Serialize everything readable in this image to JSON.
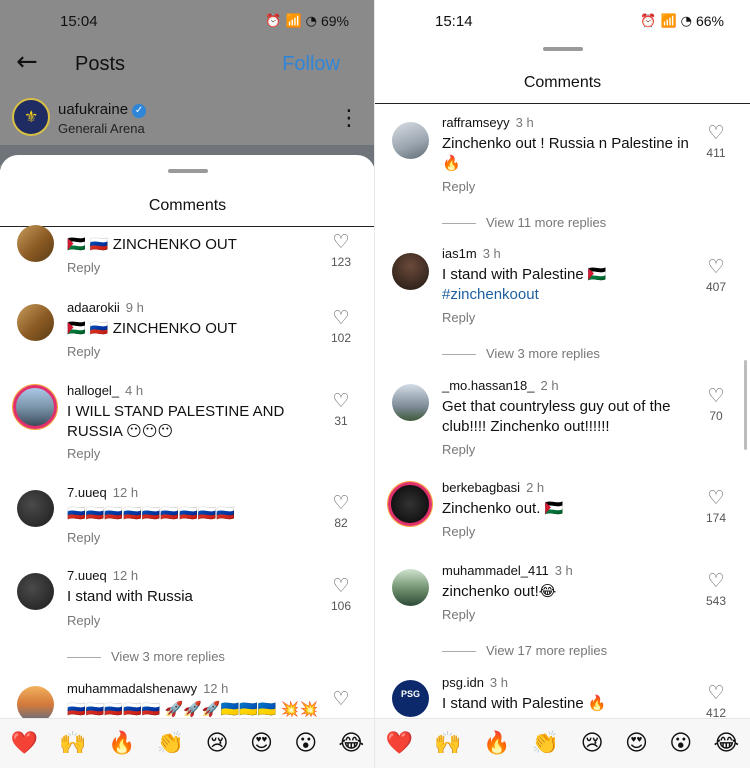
{
  "left": {
    "status": {
      "time": "15:04",
      "battery": "69%"
    },
    "topbar": {
      "title": "Posts",
      "follow_label": "Follow"
    },
    "account": {
      "name": "uafukraine",
      "location": "Generali Arena"
    },
    "sheet_title": "Comments",
    "comments": [
      {
        "user": "",
        "time": "",
        "text": "🇵🇸 🇷🇺 ZINCHENKO OUT",
        "likes": "123",
        "reply": "Reply"
      },
      {
        "user": "adaarokii",
        "time": "9 h",
        "text": "🇵🇸 🇷🇺 ZINCHENKO OUT",
        "likes": "102",
        "reply": "Reply"
      },
      {
        "user": "hallogel_",
        "time": "4 h",
        "text": "I WILL STAND PALESTINE AND RUSSIA 😶😶😶",
        "likes": "31",
        "reply": "Reply"
      },
      {
        "user": "7.uueq",
        "time": "12 h",
        "text": "🇷🇺🇷🇺🇷🇺🇷🇺🇷🇺🇷🇺🇷🇺🇷🇺🇷🇺",
        "likes": "82",
        "reply": "Reply"
      },
      {
        "user": "7.uueq",
        "time": "12 h",
        "text": "I stand with Russia",
        "likes": "106",
        "reply": "Reply"
      },
      {
        "user": "muhammadalshenawy",
        "time": "12 h",
        "text": "🇷🇺🇷🇺🇷🇺🇷🇺🇷🇺 🚀🚀🚀🇺🇦🇺🇦🇺🇦 💥💥",
        "likes": "",
        "reply": ""
      }
    ],
    "view_more": "View 3 more replies"
  },
  "right": {
    "status": {
      "time": "15:14",
      "battery": "66%"
    },
    "sheet_title": "Comments",
    "comments": [
      {
        "user": "rafframseyy",
        "time": "3 h",
        "text": "Zinchenko out ! Russia n Palestine in 🔥",
        "likes": "411",
        "reply": "Reply"
      },
      {
        "user": "ias1m",
        "time": "3 h",
        "text": "I stand with Palestine 🇵🇸",
        "hashtag": "#zinchenkoout",
        "likes": "407",
        "reply": "Reply"
      },
      {
        "user": "_mo.hassan18_",
        "time": "2 h",
        "text": "Get that countryless guy out of the club!!!! Zinchenko out!!!!!!",
        "likes": "70",
        "reply": "Reply"
      },
      {
        "user": "berkebagbasi",
        "time": "2 h",
        "text": "Zinchenko out. 🇵🇸",
        "likes": "174",
        "reply": "Reply"
      },
      {
        "user": "muhammadel_411",
        "time": "3 h",
        "text": "zinchenko out!😂",
        "likes": "543",
        "reply": "Reply"
      },
      {
        "user": "psg.idn",
        "time": "3 h",
        "text": "I stand with Palestine 🔥",
        "likes": "412",
        "reply": ""
      }
    ],
    "view_more": [
      "View 11 more replies",
      "View 3 more replies",
      "View 17 more replies"
    ]
  },
  "emoji_bar": [
    "❤️",
    "🙌",
    "🔥",
    "👏",
    "😢",
    "😍",
    "😮",
    "😂"
  ],
  "icons": {
    "back": "arrow-left-icon",
    "more": "more-vertical-icon",
    "heart": "heart-outline-icon"
  }
}
